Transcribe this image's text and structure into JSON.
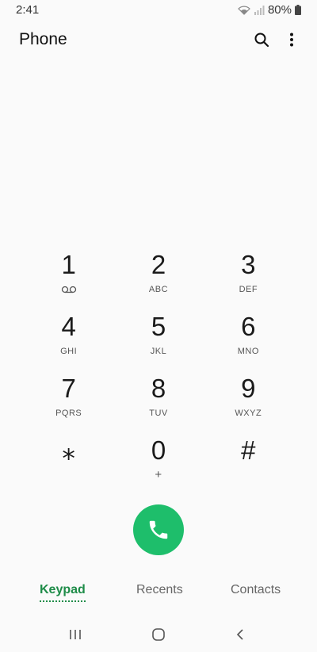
{
  "status_bar": {
    "time": "2:41",
    "battery": "80%",
    "icons": [
      "wifi-icon",
      "signal-icon",
      "battery-icon"
    ]
  },
  "header": {
    "title": "Phone",
    "search_icon": "search-icon",
    "more_icon": "more-vertical-icon"
  },
  "keypad": {
    "keys": [
      {
        "digit": "1",
        "sub": "",
        "sub_icon": "voicemail-icon"
      },
      {
        "digit": "2",
        "sub": "ABC"
      },
      {
        "digit": "3",
        "sub": "DEF"
      },
      {
        "digit": "4",
        "sub": "GHI"
      },
      {
        "digit": "5",
        "sub": "JKL"
      },
      {
        "digit": "6",
        "sub": "MNO"
      },
      {
        "digit": "7",
        "sub": "PQRS"
      },
      {
        "digit": "8",
        "sub": "TUV"
      },
      {
        "digit": "9",
        "sub": "WXYZ"
      },
      {
        "digit": "⁎",
        "sub": ""
      },
      {
        "digit": "0",
        "sub": "+"
      },
      {
        "digit": "#",
        "sub": ""
      }
    ]
  },
  "call_button": {
    "icon": "phone-icon",
    "color": "#1ebe6b"
  },
  "tabs": {
    "items": [
      {
        "label": "Keypad",
        "active": true
      },
      {
        "label": "Recents",
        "active": false
      },
      {
        "label": "Contacts",
        "active": false
      }
    ],
    "active_color": "#1e8c48"
  },
  "navbar": {
    "icons": [
      "recent-apps-icon",
      "home-icon",
      "back-icon"
    ]
  }
}
